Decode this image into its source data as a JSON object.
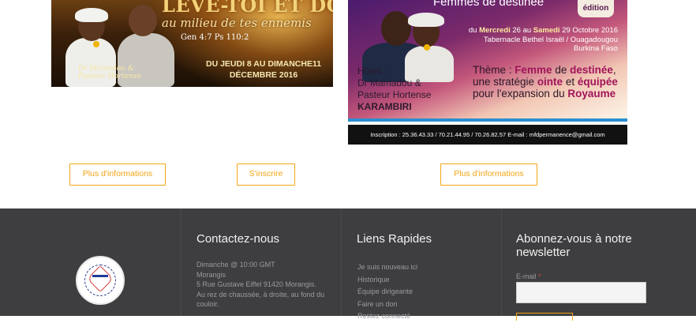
{
  "banner1": {
    "title": "LÈVE-TOI ET DOMINE",
    "subtitle": "au milieu de tes ennemis",
    "reference": "Gen 4:7 Ps 110:2",
    "dates_line1": "DU JEUDI 8 AU DIMANCHE11",
    "dates_line2": "DÉCEMBRE 2016",
    "caption_line1": "Dr Mamadou &",
    "caption_line2": "Pasteur Hortense"
  },
  "banner2": {
    "heading": "Femmes de destinée",
    "edition": "édition",
    "dates_prefix": "du",
    "dates_start": "Mercredi",
    "dates_mid": " 26 au ",
    "dates_end": "Samedi",
    "dates_suffix": " 29 Octobre 2016",
    "venue": "Tabernacle Bethel Israël / Ouagadougou",
    "country": "Burkina Faso",
    "hosts_label": "Hôtes :",
    "hosts_line1": "Dr Mamadou &",
    "hosts_line2": "Pasteur Hortense",
    "hosts_name": "KARAMBIRI",
    "theme_prefix": "Thème : ",
    "theme_w1": "Femme",
    "theme_t1": " de ",
    "theme_w2": "destinée",
    "theme_t2": ", une stratégie ",
    "theme_w3": "ointe",
    "theme_t3": " et ",
    "theme_w4": "équipée",
    "theme_t4": " pour l'expansion du ",
    "theme_w5": "Royaume",
    "footer": "Inscription : 25.36.43.33 / 70.21.44.95 / 70.26.82.57     E-mail : mfdpermanence@gmail.com"
  },
  "buttons": {
    "info1": "Plus d'informations",
    "register": "S'inscrire",
    "info2": "Plus d'informations"
  },
  "footer": {
    "contact": {
      "heading": "Contactez-nous",
      "line1": "Dimanche @ 10:00 GMT",
      "line2": "Morangis",
      "line3": "5 Rue Gustave Eiffel 91420 Morangis.",
      "line4": "Au rez de chaussée, à droite, au fond du couloir."
    },
    "links": {
      "heading": "Liens Rapides",
      "items": [
        "Je suis nouveau ici",
        "Historique",
        "Équipe dirigeante",
        "Faire un don",
        "Restez connecté"
      ]
    },
    "newsletter": {
      "heading": "Abonnez-vous à notre newsletter",
      "email_label": "E-mail",
      "required_mark": "*",
      "email_value": ""
    }
  },
  "colors": {
    "accent": "#f2a516",
    "footer_bg": "#3e3e40",
    "footer_text": "#9b9b9f"
  }
}
